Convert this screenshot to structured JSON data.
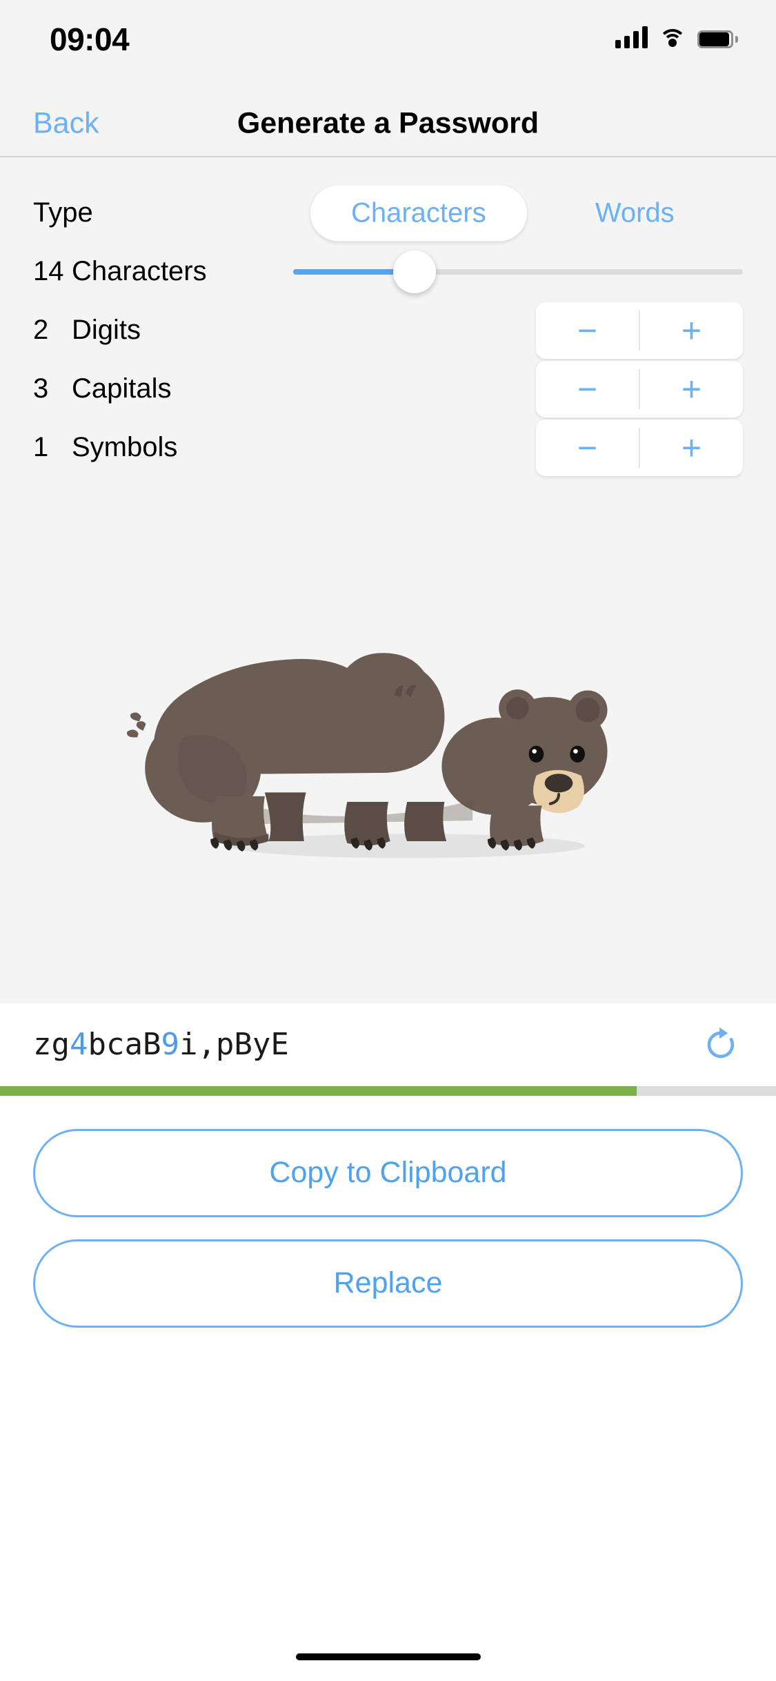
{
  "status_bar": {
    "time": "09:04",
    "signal_icon": "cellular-signal-icon",
    "wifi_icon": "wifi-icon",
    "battery_icon": "battery-icon"
  },
  "nav": {
    "back_label": "Back",
    "title": "Generate a Password"
  },
  "settings": {
    "type_row": {
      "label": "Type",
      "options": [
        "Characters",
        "Words"
      ],
      "selected": "Characters"
    },
    "length_row": {
      "value": "14",
      "label": "Characters",
      "slider_percent": 27,
      "slider_min": 1,
      "slider_max": 50
    },
    "steppers": [
      {
        "value": "2",
        "label": "Digits",
        "minus": "−",
        "plus": "+"
      },
      {
        "value": "3",
        "label": "Capitals",
        "minus": "−",
        "plus": "+"
      },
      {
        "value": "1",
        "label": "Symbols",
        "minus": "−",
        "plus": "+"
      }
    ]
  },
  "illustration": {
    "name": "bear-illustration",
    "body_color": "#6B5D54",
    "shade_color": "#5A4D45",
    "muzzle_color": "#E8CFA8",
    "eye_color": "#101010",
    "shadow_color": "#E2E2E2"
  },
  "result": {
    "password": "zg4bcaB9i,pByE",
    "password_segments": [
      {
        "text": "zg",
        "kind": "letter"
      },
      {
        "text": "4",
        "kind": "digit"
      },
      {
        "text": "bcaB",
        "kind": "letter"
      },
      {
        "text": "9",
        "kind": "digit"
      },
      {
        "text": "i,pByE",
        "kind": "letter"
      }
    ],
    "refresh_icon": "refresh-icon",
    "strength_percent": 82,
    "strength_color": "#7DB04C",
    "strength_track_color": "#DCDCDC"
  },
  "actions": {
    "copy_label": "Copy to Clipboard",
    "replace_label": "Replace"
  },
  "theme": {
    "accent": "#6CB0F5",
    "background": "#F4F4F4",
    "panel": "#FFFFFF",
    "text": "#000000"
  }
}
